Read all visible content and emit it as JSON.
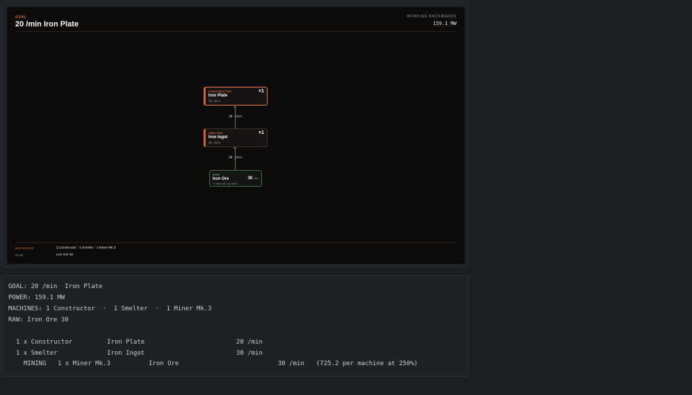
{
  "diagram": {
    "goal_caption": "GOAL",
    "goal_title": "20 /min Iron Plate",
    "working_caption": "WORKING BACKWARDS",
    "working_power": "159.1 MW",
    "nodes": [
      {
        "caption": "CONSTRUCTOR",
        "name": "Iron Plate",
        "rate": "20 /min",
        "count": "×1"
      },
      {
        "caption": "SMELTER",
        "name": "Iron Ingot",
        "rate": "30 /min",
        "count": "×1"
      },
      {
        "caption": "RAW",
        "name": "Iron Ore",
        "amount": "30",
        "unit": "/min",
        "detail": "<1 Miner Mk.3 @ 250%"
      }
    ],
    "edges": [
      {
        "label": "30 /min"
      },
      {
        "label": "30 /min"
      }
    ],
    "summary": {
      "machines_label": "MACHINES",
      "machines_value": "1 Constructor · 1 Smelter · 1 Miner Mk.3",
      "raw_label": "RAW",
      "raw_value": "Iron Ore 30"
    },
    "colors": {
      "accent": "#d86a34",
      "raw": "#5cb06a",
      "canvas_bg": "#0d0b0a",
      "panel_bg": "#1e2227"
    }
  },
  "text_report": {
    "lines": [
      "GOAL: 20 /min  Iron Plate",
      "POWER: 159.1 MW",
      "MACHINES: 1 Constructor  ·  1 Smelter  ·  1 Miner Mk.3",
      "RAW: Iron Ore 30"
    ],
    "rows": [
      {
        "machine": "1 x Constructor",
        "item": "Iron Plate",
        "rate": "20 /min"
      },
      {
        "machine": "1 x Smelter",
        "item": "Iron Ingot",
        "rate": "30 /min"
      }
    ],
    "mining": {
      "tag": "MINING",
      "machine": "1 x Miner Mk.3",
      "item": "Iron Ore",
      "rate": "30 /min",
      "note": "(725.2 per machine at 250%)"
    }
  }
}
